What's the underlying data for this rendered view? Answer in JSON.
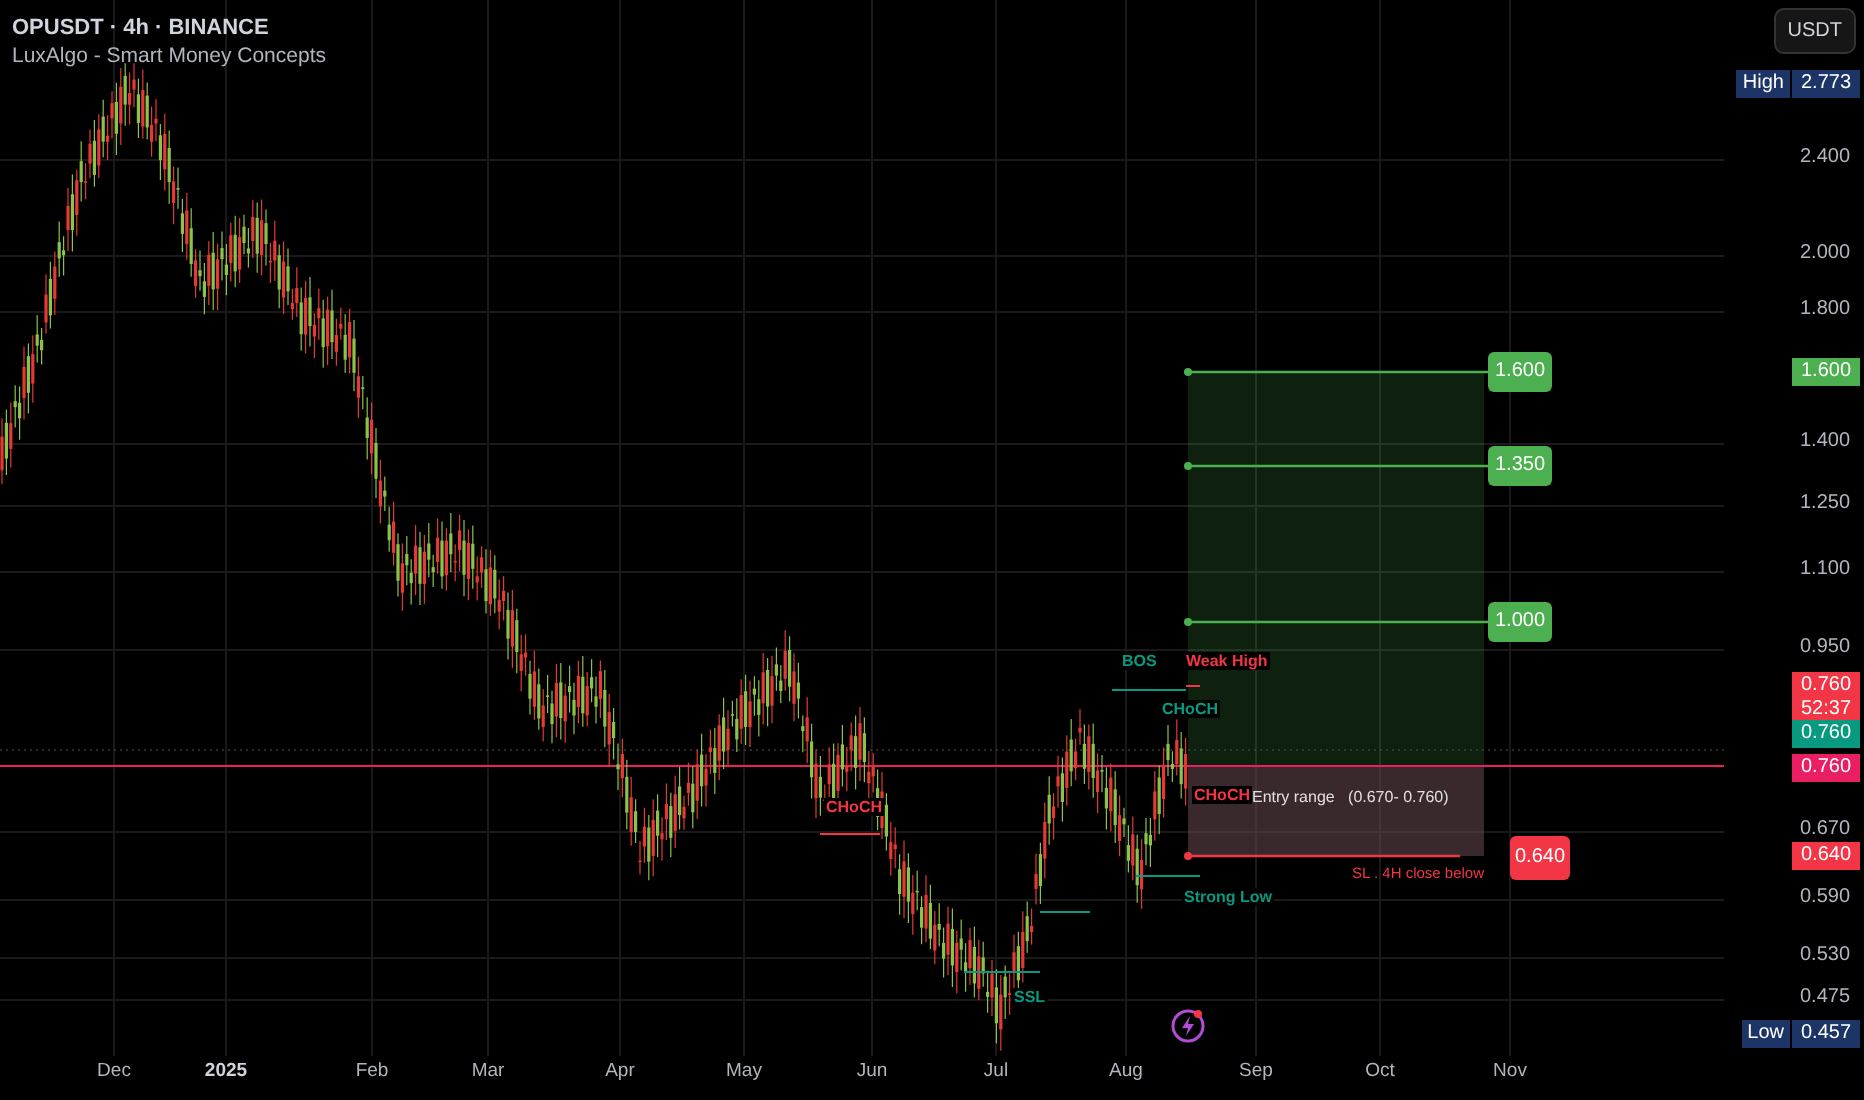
{
  "header": {
    "symbol": "OPUSDT · 4h · BINANCE",
    "indicator": "LuxAlgo - Smart Money Concepts"
  },
  "currency_button": "USDT",
  "price_ticks": [
    "2.400",
    "2.000",
    "1.800",
    "1.400",
    "1.250",
    "1.100",
    "0.950",
    "0.670",
    "0.590",
    "0.530",
    "0.475"
  ],
  "price_badges": [
    {
      "label": "High",
      "value": "2.773",
      "color": "#1c3466"
    },
    {
      "value": "1.600",
      "color": "#4caf50"
    },
    {
      "value": "0.760",
      "countdown": "52:37",
      "color": "#f23645"
    },
    {
      "value": "0.760",
      "color": "#089981"
    },
    {
      "value": "0.760",
      "color": "#e91e63"
    },
    {
      "value": "0.640",
      "color": "#f23645"
    },
    {
      "label": "Low",
      "value": "0.457",
      "color": "#1c3466"
    }
  ],
  "time_axis": [
    {
      "label": "Dec",
      "bold": false
    },
    {
      "label": "2025",
      "bold": true
    },
    {
      "label": "Feb",
      "bold": false
    },
    {
      "label": "Mar",
      "bold": false
    },
    {
      "label": "Apr",
      "bold": false
    },
    {
      "label": "May",
      "bold": false
    },
    {
      "label": "Jun",
      "bold": false
    },
    {
      "label": "Jul",
      "bold": false
    },
    {
      "label": "Aug",
      "bold": false
    },
    {
      "label": "Sep",
      "bold": false
    },
    {
      "label": "Oct",
      "bold": false
    },
    {
      "label": "Nov",
      "bold": false
    }
  ],
  "targets": [
    {
      "value": "1.600"
    },
    {
      "value": "1.350"
    },
    {
      "value": "1.000"
    }
  ],
  "entry_zone": {
    "text": "Entry range   (0.670- 0.760)"
  },
  "stop_loss": {
    "value": "0.640",
    "text": "SL . 4H close below"
  },
  "smc_labels": [
    {
      "text": "BOS",
      "kind": "bullish"
    },
    {
      "text": "Weak High",
      "kind": "bearish"
    },
    {
      "text": "CHoCH",
      "kind": "bullish"
    },
    {
      "text": "CHoCH",
      "kind": "bearish"
    },
    {
      "text": "CHoCH",
      "kind": "bearish"
    },
    {
      "text": "Strong Low",
      "kind": "bullish"
    },
    {
      "text": "SSL",
      "kind": "bullish"
    }
  ]
}
